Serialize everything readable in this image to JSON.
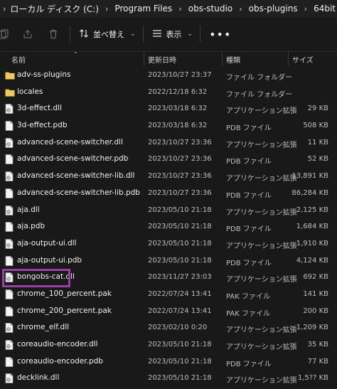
{
  "breadcrumb": [
    {
      "label": "ローカル ディスク (C:)"
    },
    {
      "label": "Program Files"
    },
    {
      "label": "obs-studio"
    },
    {
      "label": "obs-plugins"
    },
    {
      "label": "64bit"
    }
  ],
  "toolbar": {
    "sort_label": "並べ替え",
    "view_label": "表示",
    "more_label": "•••"
  },
  "columns": {
    "name": "名前",
    "date": "更新日時",
    "type": "種類",
    "size": "サイズ"
  },
  "files": [
    {
      "name": "adv-ss-plugins",
      "date": "2023/10/27 23:37",
      "type": "ファイル フォルダー",
      "size": "",
      "kind": "folder"
    },
    {
      "name": "locales",
      "date": "2022/12/18 6:32",
      "type": "ファイル フォルダー",
      "size": "",
      "kind": "folder"
    },
    {
      "name": "3d-effect.dll",
      "date": "2023/03/18 6:32",
      "type": "アプリケーション拡張",
      "size": "29 KB",
      "kind": "dll"
    },
    {
      "name": "3d-effect.pdb",
      "date": "2023/03/18 6:32",
      "type": "PDB ファイル",
      "size": "508 KB",
      "kind": "file"
    },
    {
      "name": "advanced-scene-switcher.dll",
      "date": "2023/10/27 23:36",
      "type": "アプリケーション拡張",
      "size": "11 KB",
      "kind": "dll"
    },
    {
      "name": "advanced-scene-switcher.pdb",
      "date": "2023/10/27 23:36",
      "type": "PDB ファイル",
      "size": "52 KB",
      "kind": "file"
    },
    {
      "name": "advanced-scene-switcher-lib.dll",
      "date": "2023/10/27 23:36",
      "type": "アプリケーション拡張",
      "size": "13,891 KB",
      "kind": "dll"
    },
    {
      "name": "advanced-scene-switcher-lib.pdb",
      "date": "2023/10/27 23:36",
      "type": "PDB ファイル",
      "size": "86,284 KB",
      "kind": "file"
    },
    {
      "name": "aja.dll",
      "date": "2023/05/10 21:18",
      "type": "アプリケーション拡張",
      "size": "2,125 KB",
      "kind": "dll"
    },
    {
      "name": "aja.pdb",
      "date": "2023/05/10 21:18",
      "type": "PDB ファイル",
      "size": "1,684 KB",
      "kind": "file"
    },
    {
      "name": "aja-output-ui.dll",
      "date": "2023/05/10 21:18",
      "type": "アプリケーション拡張",
      "size": "1,910 KB",
      "kind": "dll"
    },
    {
      "name": "aja-output-ui.pdb",
      "date": "2023/05/10 21:18",
      "type": "PDB ファイル",
      "size": "4,124 KB",
      "kind": "file"
    },
    {
      "name": "bongobs-cat.dll",
      "date": "2023/11/27 23:03",
      "type": "アプリケーション拡張",
      "size": "692 KB",
      "kind": "dll"
    },
    {
      "name": "chrome_100_percent.pak",
      "date": "2022/07/24 13:41",
      "type": "PAK ファイル",
      "size": "141 KB",
      "kind": "file"
    },
    {
      "name": "chrome_200_percent.pak",
      "date": "2022/07/24 13:41",
      "type": "PAK ファイル",
      "size": "200 KB",
      "kind": "file"
    },
    {
      "name": "chrome_elf.dll",
      "date": "2023/02/10 0:20",
      "type": "アプリケーション拡張",
      "size": "1,209 KB",
      "kind": "dll"
    },
    {
      "name": "coreaudio-encoder.dll",
      "date": "2023/05/10 21:18",
      "type": "アプリケーション拡張",
      "size": "35 KB",
      "kind": "dll"
    },
    {
      "name": "coreaudio-encoder.pdb",
      "date": "2023/05/10 21:18",
      "type": "PDB ファイル",
      "size": "77 KB",
      "kind": "file"
    },
    {
      "name": "decklink.dll",
      "date": "2023/05/10 21:18",
      "type": "アプリケーション拡張",
      "size": "1,5?? KB",
      "kind": "dll"
    }
  ],
  "colors": {
    "background": "#191919",
    "highlight": "#9b3fa6",
    "folder": "#e8b84a"
  }
}
